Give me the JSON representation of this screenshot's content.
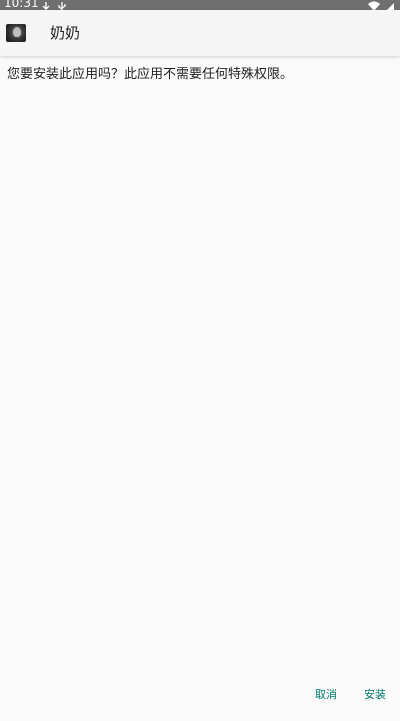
{
  "status_bar": {
    "time": "10:31",
    "icons": [
      "download-icon",
      "usb-icon",
      "wifi-icon",
      "battery-icon"
    ]
  },
  "header": {
    "app_icon": "app-thumbnail-icon",
    "app_name": "奶奶"
  },
  "main": {
    "message": "您要安装此应用吗？此应用不需要任何特殊权限。"
  },
  "actions": {
    "cancel_label": "取消",
    "install_label": "安装"
  },
  "colors": {
    "accent": "#00796b",
    "status_bar": "#6f6f6f",
    "background": "#fafafa",
    "header_background": "#f5f5f5",
    "text": "#212121"
  }
}
